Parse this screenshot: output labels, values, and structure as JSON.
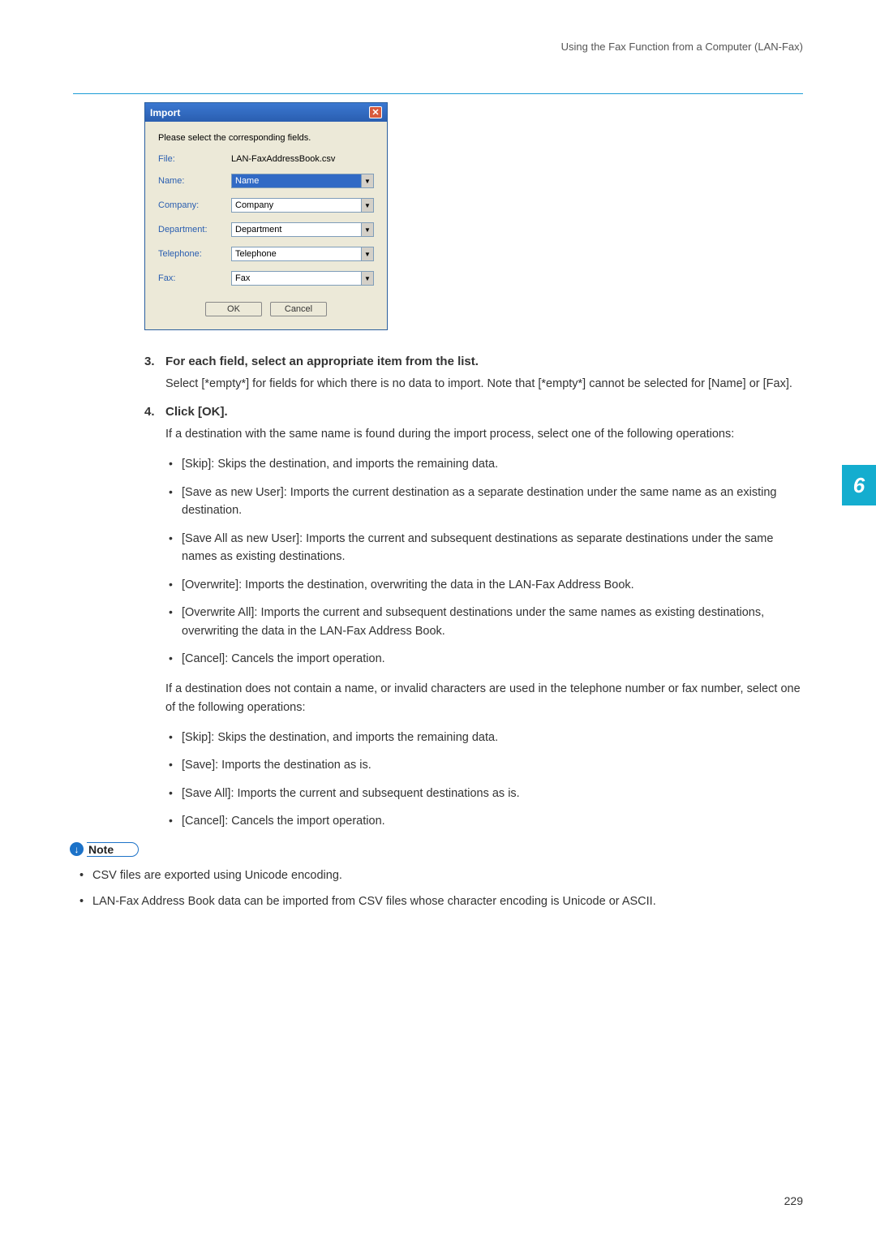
{
  "header": {
    "breadcrumb": "Using the Fax Function from a Computer (LAN-Fax)"
  },
  "chapter": "6",
  "pageNum": "229",
  "dialog": {
    "title": "Import",
    "instruction": "Please select the corresponding fields.",
    "fileLabel": "File:",
    "fileValue": "LAN-FaxAddressBook.csv",
    "nameLabel": "Name:",
    "nameValue": "Name",
    "companyLabel": "Company:",
    "companyValue": "Company",
    "departmentLabel": "Department:",
    "departmentValue": "Department",
    "telephoneLabel": "Telephone:",
    "telephoneValue": "Telephone",
    "faxLabel": "Fax:",
    "faxValue": "Fax",
    "ok": "OK",
    "cancel": "Cancel"
  },
  "steps": {
    "s3": {
      "num": "3.",
      "title": "For each field, select an appropriate item from the list.",
      "body": "Select [*empty*] for fields for which there is no data to import. Note that [*empty*] cannot be selected for [Name] or [Fax]."
    },
    "s4": {
      "num": "4.",
      "title": "Click [OK].",
      "intro": "If a destination with the same name is found during the import process, select one of the following operations:",
      "ops1": {
        "b1": "[Skip]: Skips the destination, and imports the remaining data.",
        "b2": "[Save as new User]: Imports the current destination as a separate destination under the same name as an existing destination.",
        "b3": "[Save All as new User]: Imports the current and subsequent destinations as separate destinations under the same names as existing destinations.",
        "b4": "[Overwrite]: Imports the destination, overwriting the data in the LAN-Fax Address Book.",
        "b5": "[Overwrite All]: Imports the current and subsequent destinations under the same names as existing destinations, overwriting the data in the LAN-Fax Address Book.",
        "b6": "[Cancel]: Cancels the import operation."
      },
      "intro2": "If a destination does not contain a name, or invalid characters are used in the telephone number or fax number, select one of the following operations:",
      "ops2": {
        "b1": "[Skip]: Skips the destination, and imports the remaining data.",
        "b2": "[Save]: Imports the destination as is.",
        "b3": "[Save All]: Imports the current and subsequent destinations as is.",
        "b4": "[Cancel]: Cancels the import operation."
      }
    }
  },
  "note": {
    "label": "Note",
    "n1": "CSV files are exported using Unicode encoding.",
    "n2": "LAN-Fax Address Book data can be imported from CSV files whose character encoding is Unicode or ASCII."
  }
}
